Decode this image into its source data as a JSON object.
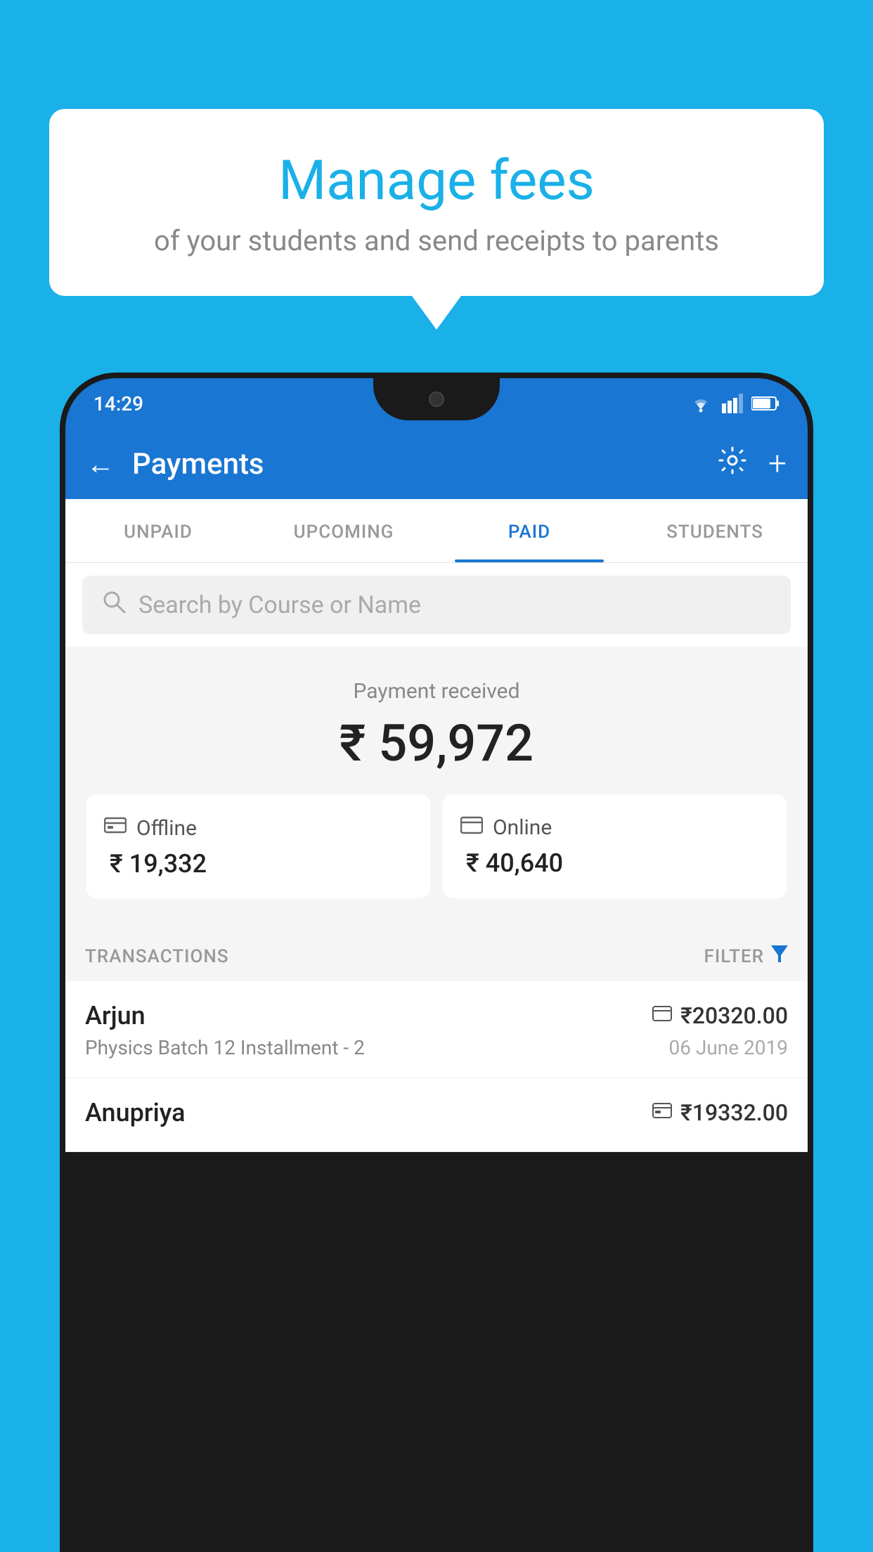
{
  "background_color": "#1ab0e8",
  "bubble": {
    "title": "Manage fees",
    "subtitle": "of your students and send receipts to parents"
  },
  "status_bar": {
    "time": "14:29"
  },
  "header": {
    "title": "Payments",
    "back_label": "←",
    "settings_icon": "gear-icon",
    "add_icon": "plus-icon"
  },
  "tabs": [
    {
      "label": "UNPAID",
      "active": false
    },
    {
      "label": "UPCOMING",
      "active": false
    },
    {
      "label": "PAID",
      "active": true
    },
    {
      "label": "STUDENTS",
      "active": false
    }
  ],
  "search": {
    "placeholder": "Search by Course or Name"
  },
  "payment_section": {
    "label": "Payment received",
    "amount": "₹ 59,972",
    "offline": {
      "type": "Offline",
      "amount": "₹ 19,332"
    },
    "online": {
      "type": "Online",
      "amount": "₹ 40,640"
    }
  },
  "transactions": {
    "header_label": "TRANSACTIONS",
    "filter_label": "FILTER",
    "rows": [
      {
        "name": "Arjun",
        "course": "Physics Batch 12 Installment - 2",
        "amount": "₹20320.00",
        "date": "06 June 2019",
        "payment_type": "online"
      },
      {
        "name": "Anupriya",
        "course": "",
        "amount": "₹19332.00",
        "date": "",
        "payment_type": "offline"
      }
    ]
  }
}
